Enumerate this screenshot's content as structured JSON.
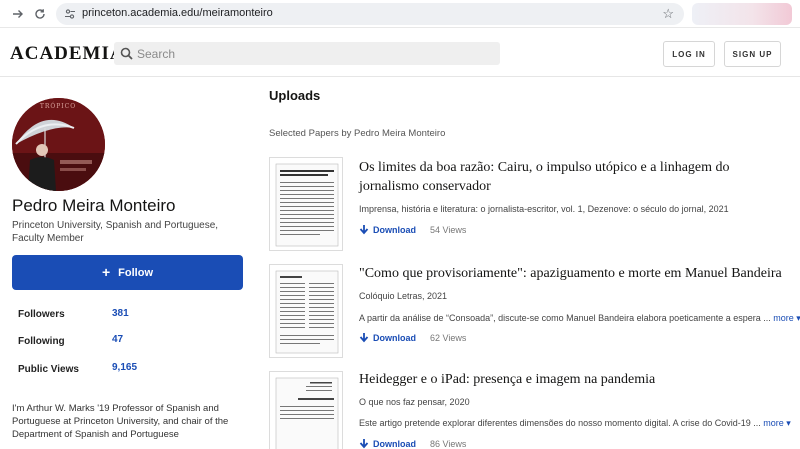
{
  "browser": {
    "url": "princeton.academia.edu/meiramonteiro",
    "back_icon": "arrow-right-icon",
    "reload_icon": "reload-icon"
  },
  "header": {
    "logo": "ACADEMIA",
    "search_placeholder": "Search",
    "login_label": "LOG IN",
    "signup_label": "SIGN UP"
  },
  "profile": {
    "name": "Pedro Meira Monteiro",
    "affiliation": "Princeton University, Spanish and Portuguese, Faculty Member",
    "follow_label": "Follow",
    "avatar_text": "TRÓPICO",
    "stats": [
      {
        "label": "Followers",
        "value": "381"
      },
      {
        "label": "Following",
        "value": "47"
      },
      {
        "label": "Public Views",
        "value": "9,165"
      }
    ],
    "bio": "I'm Arthur W. Marks '19 Professor of Spanish and Portuguese at Princeton University, and chair of the Department of Spanish and Portuguese"
  },
  "main": {
    "uploads_title": "Uploads",
    "selected_label": "Selected Papers by Pedro Meira Monteiro",
    "papers": [
      {
        "title": "Os limites da boa razão: Cairu, o impulso utópico e a linhagem do jornalismo conservador",
        "meta": "Imprensa, história e literatura: o jornalista-escritor, vol. 1, Dezenove: o século do jornal, 2021",
        "abstract": "",
        "download_label": "Download",
        "views": "54 Views"
      },
      {
        "title": "\"Como que provisoriamente\": apaziguamento e morte em Manuel Bandeira",
        "meta": "Colóquio Letras, 2021",
        "abstract": "A partir da análise de “Consoada”, discute-se como Manuel Bandeira elabora poeticamente a espera ...",
        "more_label": "more",
        "download_label": "Download",
        "views": "62 Views"
      },
      {
        "title": "Heidegger e o iPad: presença e imagem na pandemia",
        "meta": "O que nos faz pensar, 2020",
        "abstract": "Este artigo pretende explorar diferentes dimensões do nosso momento digital. A crise do Covid-19 ...",
        "more_label": "more",
        "download_label": "Download",
        "views": "86 Views"
      }
    ]
  },
  "colors": {
    "accent": "#1a4db5",
    "avatar_bg": "#6b1416"
  }
}
